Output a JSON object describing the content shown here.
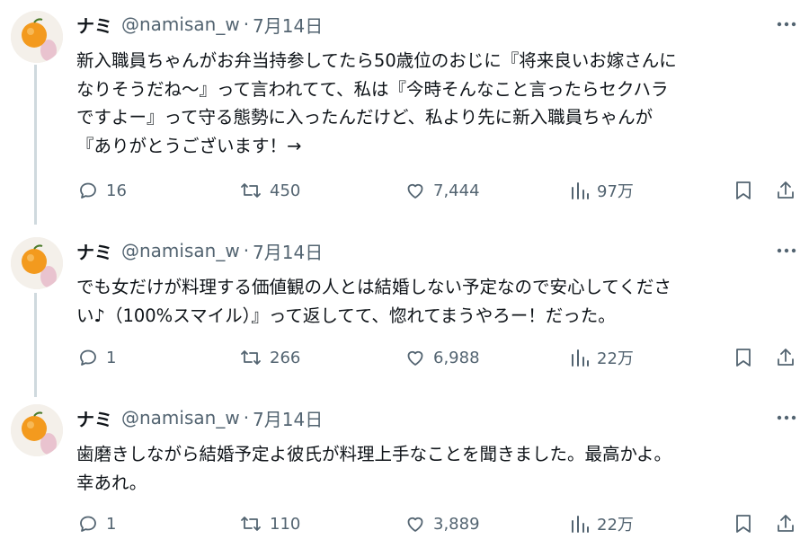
{
  "tweets": [
    {
      "name": "ナミ",
      "handle": "@namisan_w",
      "separator": "·",
      "date": "7月14日",
      "lines": [
        "新入職員ちゃんがお弁当持参してたら50歳位のおじに『将来良いお嫁さんに",
        "なりそうだね〜』って言われてて、私は『今時そんなこと言ったらセクハラ",
        "ですよー』って守る態勢に入ったんだけど、私より先に新入職員ちゃんが",
        "『ありがとうございます！→"
      ],
      "replies": "16",
      "reposts": "450",
      "likes": "7,444",
      "views": "97万"
    },
    {
      "name": "ナミ",
      "handle": "@namisan_w",
      "separator": "·",
      "date": "7月14日",
      "lines": [
        "でも女だけが料理する価値観の人とは結婚しない予定なので安心してくださ",
        "い♪（100%スマイル）』って返してて、惚れてまうやろー！だった。"
      ],
      "replies": "1",
      "reposts": "266",
      "likes": "6,988",
      "views": "22万"
    },
    {
      "name": "ナミ",
      "handle": "@namisan_w",
      "separator": "·",
      "date": "7月14日",
      "lines": [
        "歯磨きしながら結婚予定よ彼氏が料理上手なことを聞きました。最高かよ。",
        "幸あれ。"
      ],
      "replies": "1",
      "reposts": "110",
      "likes": "3,889",
      "views": "22万"
    }
  ],
  "colors": {
    "text": "#0f1419",
    "secondary": "#536471",
    "thread_line": "#cfd9de",
    "avatar_fruit": "#f39a1e"
  },
  "icons": {
    "reply": "reply-icon",
    "repost": "repost-icon",
    "like": "heart-icon",
    "views": "views-chart-icon",
    "bookmark": "bookmark-icon",
    "share": "share-icon",
    "more": "more-dots-icon"
  }
}
